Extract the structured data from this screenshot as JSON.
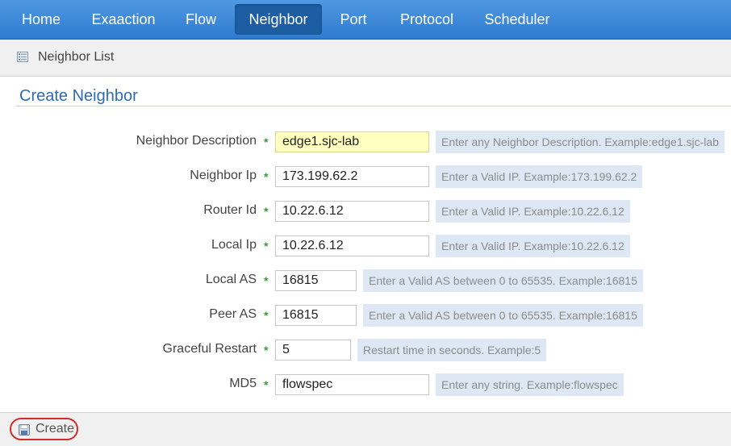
{
  "nav": {
    "items": [
      {
        "label": "Home"
      },
      {
        "label": "Exaaction"
      },
      {
        "label": "Flow"
      },
      {
        "label": "Neighbor"
      },
      {
        "label": "Port"
      },
      {
        "label": "Protocol"
      },
      {
        "label": "Scheduler"
      }
    ],
    "active": "Neighbor"
  },
  "breadcrumb": {
    "icon": "list-icon",
    "label": "Neighbor List"
  },
  "section": {
    "title": "Create Neighbor"
  },
  "form": {
    "required_mark": "*",
    "fields": [
      {
        "label": "Neighbor Description",
        "value": "edge1.sjc-lab",
        "hint": "Enter any Neighbor Description. Example:edge1.sjc-lab"
      },
      {
        "label": "Neighbor Ip",
        "value": "173.199.62.2",
        "hint": "Enter a Valid IP. Example:173.199.62.2"
      },
      {
        "label": "Router Id",
        "value": "10.22.6.12",
        "hint": "Enter a Valid IP. Example:10.22.6.12"
      },
      {
        "label": "Local Ip",
        "value": "10.22.6.12",
        "hint": "Enter a Valid IP. Example:10.22.6.12"
      },
      {
        "label": "Local AS",
        "value": "16815",
        "hint": "Enter a Valid AS between 0 to 65535. Example:16815"
      },
      {
        "label": "Peer AS",
        "value": "16815",
        "hint": "Enter a Valid AS between 0 to 65535. Example:16815"
      },
      {
        "label": "Graceful Restart",
        "value": "5",
        "hint": "Restart time in seconds. Example:5"
      },
      {
        "label": "MD5",
        "value": "flowspec",
        "hint": "Enter any string. Example:flowspec"
      }
    ]
  },
  "footer": {
    "create_label": "Create",
    "create_icon": "save-icon"
  },
  "colors": {
    "nav_bg": "#2f7bcf",
    "nav_active": "#1d5ea3",
    "title": "#2c6bb3",
    "focused_input": "#ffffc0",
    "hint_bg": "#dde8f4",
    "required": "#3a9a3a",
    "highlight_ring": "#d32b2b"
  }
}
